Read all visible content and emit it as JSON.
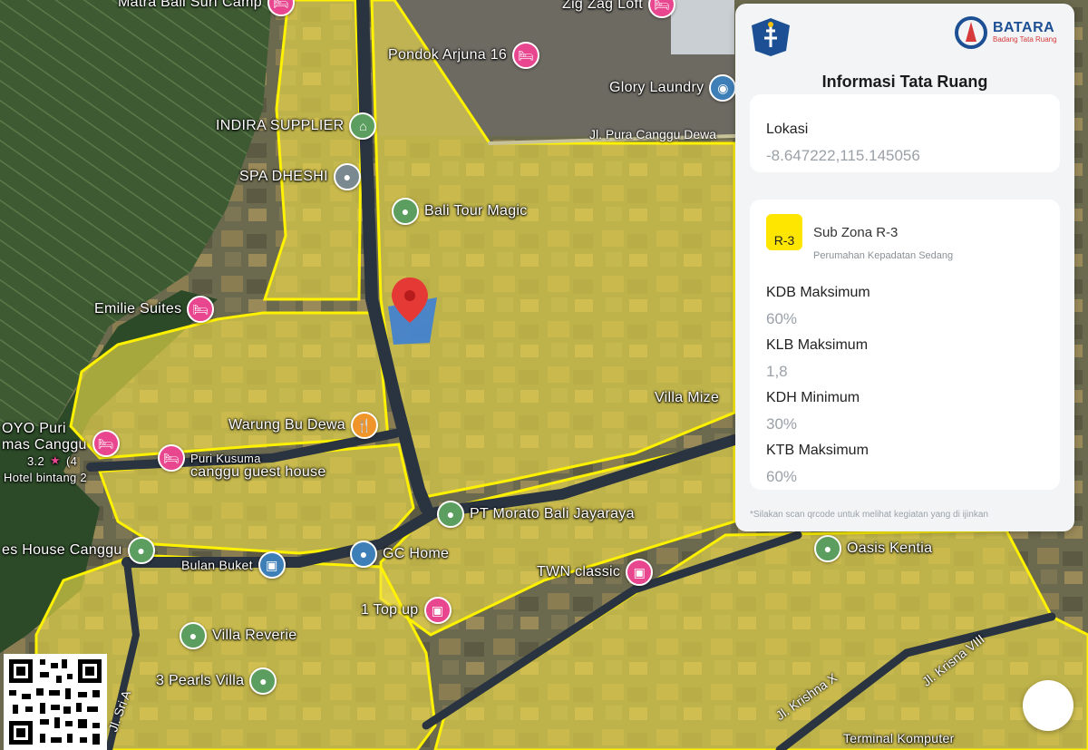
{
  "map": {
    "colors": {
      "zone_fill": "#f2e14a",
      "zone_stroke": "#fff200",
      "marker": "#e53935",
      "parcel": "#3d7fd6"
    },
    "pois": [
      {
        "id": "matra",
        "label": "Matra Bali Surf Camp",
        "icon": "hotel-icon"
      },
      {
        "id": "zigzag",
        "label": "Zig Zag Loft",
        "icon": "hotel-icon"
      },
      {
        "id": "pondok",
        "label": "Pondok Arjuna 16",
        "icon": "hotel-icon"
      },
      {
        "id": "glory",
        "label": "Glory Laundry",
        "icon": "laundry-icon"
      },
      {
        "id": "indira",
        "label": "INDIRA SUPPLIER",
        "icon": "shop-icon"
      },
      {
        "id": "spa",
        "label": "SPA DHESHI",
        "icon": "spa-icon"
      },
      {
        "id": "tour",
        "label": "Bali Tour Magic",
        "icon": "place-icon"
      },
      {
        "id": "emilie",
        "label": "Emilie Suites",
        "icon": "hotel-icon"
      },
      {
        "id": "warung",
        "label": "Warung Bu Dewa",
        "icon": "restaurant-icon"
      },
      {
        "id": "oyo",
        "label": "OYO Puri\nmas Canggu",
        "icon": "hotel-icon"
      },
      {
        "id": "puri",
        "label": "Puri Kusuma",
        "icon": "hotel-icon"
      },
      {
        "id": "guesthouse",
        "label": "canggu guest house",
        "icon": ""
      },
      {
        "id": "villamize",
        "label": "Villa Mize",
        "icon": ""
      },
      {
        "id": "morato",
        "label": "PT Morato Bali Jayaraya",
        "icon": "place-icon"
      },
      {
        "id": "oasis",
        "label": "Oasis Kentia",
        "icon": "place-icon"
      },
      {
        "id": "houses",
        "label": "es House Canggu",
        "icon": "place-icon"
      },
      {
        "id": "bulan",
        "label": "Bulan Buket",
        "icon": "shop-icon"
      },
      {
        "id": "gchome",
        "label": "GC Home",
        "icon": "place-icon"
      },
      {
        "id": "twn",
        "label": "TWN classic",
        "icon": "shop-icon"
      },
      {
        "id": "topup",
        "label": "1 Top up",
        "icon": "shop-icon"
      },
      {
        "id": "reverie",
        "label": "Villa Reverie",
        "icon": "place-icon"
      },
      {
        "id": "pearls",
        "label": "3 Pearls Villa",
        "icon": "place-icon"
      },
      {
        "id": "terminal",
        "label": "Terminal Komputer",
        "icon": ""
      }
    ],
    "rating": {
      "score": "3.2",
      "star": "★",
      "count": "(4",
      "category": "Hotel bintang 2"
    },
    "streets": [
      {
        "id": "canggu",
        "label": "Jl. Pura Canggu Dewa"
      },
      {
        "id": "krishnax",
        "label": "Jl. Krishna X"
      },
      {
        "id": "krishnaviii",
        "label": "Jl. Krisna VIII"
      },
      {
        "id": "sriv",
        "label": "Jl. Sri A"
      }
    ]
  },
  "panel": {
    "logo_right_text": "BATARA",
    "logo_right_sub": "Badang Tata Ruang",
    "title": "Informasi Tata Ruang",
    "location": {
      "label": "Lokasi",
      "value": "-8.647222,115.145056"
    },
    "zone": {
      "code": "R-3",
      "title": "Sub Zona R-3",
      "subtitle": "Perumahan Kepadatan Sedang",
      "color": "#ffe600",
      "metrics": [
        {
          "label": "KDB Maksimum",
          "value": "60%"
        },
        {
          "label": "KLB Maksimum",
          "value": "1,8"
        },
        {
          "label": "KDH Minimum",
          "value": "30%"
        },
        {
          "label": "KTB Maksimum",
          "value": "60%"
        }
      ]
    },
    "note": "*Silakan scan qrcode untuk melihat kegiatan yang di ijinkan"
  }
}
